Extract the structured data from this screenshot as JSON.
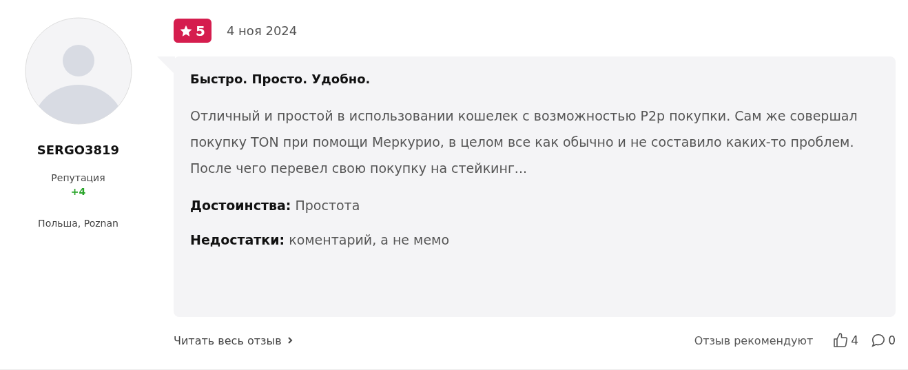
{
  "author": {
    "name": "SERGO3819",
    "reputation_label": "Репутация",
    "reputation": "+4",
    "location": "Польша, Poznan"
  },
  "review": {
    "rating": "5",
    "date": "4 ноя 2024",
    "title": "Быстро. Просто. Удобно.",
    "text": "Отличный и простой в использовании кошелек с возможностью P2p покупки. Сам же совершал покупку TON при помощи Меркурио, в целом все как обычно и не составило каких-то проблем. После чего перевел свою покупку на стейкинг...",
    "pros_label": "Достоинства:",
    "pros": "Простота",
    "cons_label": "Недостатки:",
    "cons": "коментарий, а не мемо"
  },
  "footer": {
    "read_more": "Читать весь отзыв",
    "recommend_label": "Отзыв рекомендуют",
    "likes": "4",
    "comments": "0"
  }
}
